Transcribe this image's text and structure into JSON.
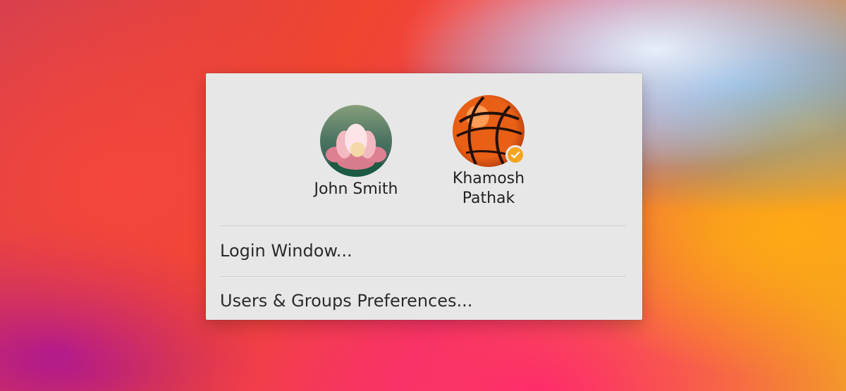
{
  "menu": {
    "users": [
      {
        "name": "John Smith",
        "avatar_icon": "lotus-avatar-icon",
        "selected": false
      },
      {
        "name": "Khamosh Pathak",
        "avatar_icon": "basketball-avatar-icon",
        "selected": true
      }
    ],
    "badge_icon": "checkmark-icon",
    "items": [
      {
        "label": "Login Window..."
      },
      {
        "label": "Users & Groups Preferences..."
      }
    ]
  },
  "colors": {
    "menu_background": "#e7e7e7",
    "selected_badge": "#f7a51f",
    "separator": "#cfcfcf",
    "text": "#222222"
  }
}
